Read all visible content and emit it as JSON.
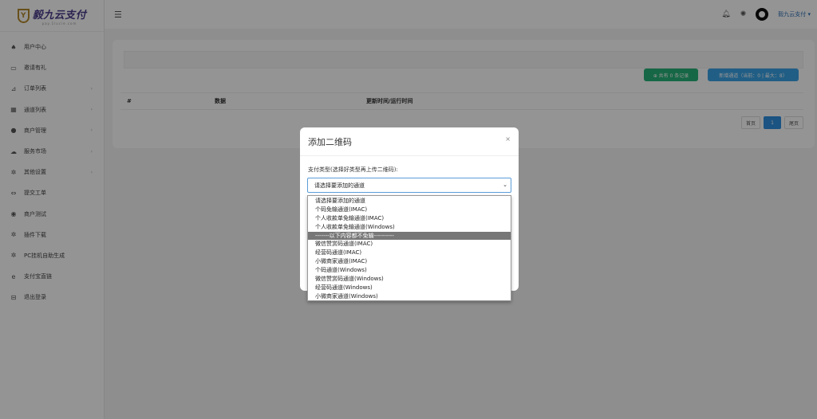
{
  "brand": {
    "badge": "Y",
    "name": "毅九云支付",
    "sub": "pay.1lucie.com"
  },
  "sidebar": {
    "items": [
      {
        "label": "用户中心",
        "icon": "home-icon",
        "glyph": "♠",
        "arrow": ""
      },
      {
        "label": "邀请有礼",
        "icon": "monitor-icon",
        "glyph": "▭",
        "arrow": ""
      },
      {
        "label": "订单列表",
        "icon": "cart-icon",
        "glyph": "⊿",
        "arrow": "›"
      },
      {
        "label": "通道列表",
        "icon": "grid-icon",
        "glyph": "▦",
        "arrow": "›"
      },
      {
        "label": "商户管理",
        "icon": "user-icon",
        "glyph": "●",
        "arrow": "›"
      },
      {
        "label": "服务市场",
        "icon": "cloud-icon",
        "glyph": "☁",
        "arrow": "›"
      },
      {
        "label": "其他设置",
        "icon": "gear-icon",
        "glyph": "✲",
        "arrow": "›"
      },
      {
        "label": "提交工单",
        "icon": "ticket-icon",
        "glyph": "⇔",
        "arrow": ""
      },
      {
        "label": "商户测试",
        "icon": "compass-icon",
        "glyph": "◉",
        "arrow": ""
      },
      {
        "label": "插件下载",
        "icon": "plugin-icon",
        "glyph": "✲",
        "arrow": ""
      },
      {
        "label": "PC挂机自助生成",
        "icon": "settings-icon",
        "glyph": "✲",
        "arrow": ""
      },
      {
        "label": "支付宝直链",
        "icon": "browser-icon",
        "glyph": "e",
        "arrow": ""
      },
      {
        "label": "退出登录",
        "icon": "logout-icon",
        "glyph": "⊟",
        "arrow": ""
      }
    ]
  },
  "header": {
    "user": "毅九云支付 ▾"
  },
  "main": {
    "total_button": "⊕ 共有 0 条记录",
    "add_button": "新增通道（当前：0 | 最大：8）",
    "columns": [
      "#",
      "数据",
      "更新时间/运行时间"
    ],
    "pager": {
      "first": "首页",
      "current": "1",
      "last": "尾页"
    }
  },
  "modal": {
    "title": "添加二维码",
    "close": "×",
    "field_label": "支付类型(选择好类型再上传二维码):",
    "selected": "请选择要添加的通道",
    "caret": "⌄",
    "options": [
      "请选择要添加的通道",
      "个码免输通道(IMAC)",
      "个人收款单免输通道(IMAC)",
      "个人收款单免输通道(Windows)",
      "-------以下内容都不免输----------",
      "微信赞赏码通道(IMAC)",
      "经营码通道(IMAC)",
      "小微商家通道(IMAC)",
      "个码通道(Windows)",
      "微信赞赏码通道(Windows)",
      "经营码通道(Windows)",
      "小微商家通道(Windows)"
    ],
    "highlighted_index": 4
  },
  "colors": {
    "green": "#27b277",
    "blue": "#3aa2e6",
    "pager_active": "#2f8fe0",
    "brand": "#4b3c8a",
    "badge": "#b48b2e",
    "option_highlight": "#777777"
  }
}
